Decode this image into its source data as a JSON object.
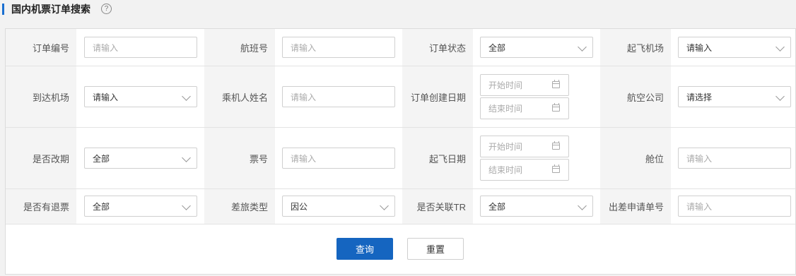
{
  "header": {
    "title": "国内机票订单搜索",
    "help_icon": "?"
  },
  "fields": {
    "order_no": {
      "label": "订单编号",
      "placeholder": "请输入"
    },
    "flight_no": {
      "label": "航班号",
      "placeholder": "请输入"
    },
    "order_status": {
      "label": "订单状态",
      "value": "全部"
    },
    "dep_airport": {
      "label": "起飞机场",
      "value": "请输入"
    },
    "arr_airport": {
      "label": "到达机场",
      "value": "请输入"
    },
    "passenger_name": {
      "label": "乘机人姓名",
      "placeholder": "请输入"
    },
    "create_date": {
      "label": "订单创建日期",
      "start_placeholder": "开始时间",
      "end_placeholder": "结束时间"
    },
    "airline": {
      "label": "航空公司",
      "value": "请选择"
    },
    "is_changed": {
      "label": "是否改期",
      "value": "全部"
    },
    "ticket_no": {
      "label": "票号",
      "placeholder": "请输入"
    },
    "dep_date": {
      "label": "起飞日期",
      "start_placeholder": "开始时间",
      "end_placeholder": "结束时间"
    },
    "cabin": {
      "label": "舱位",
      "placeholder": "请输入"
    },
    "has_refund": {
      "label": "是否有退票",
      "value": "全部"
    },
    "travel_type": {
      "label": "差旅类型",
      "value": "因公"
    },
    "linked_tr": {
      "label": "是否关联TR",
      "value": "全部"
    },
    "trip_request_no": {
      "label": "出差申请单号",
      "placeholder": "请输入"
    }
  },
  "buttons": {
    "search": "查询",
    "reset": "重置"
  }
}
